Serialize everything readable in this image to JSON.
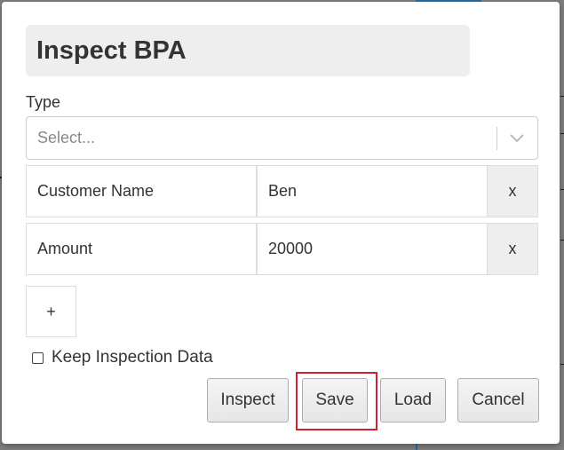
{
  "dialog": {
    "title": "Inspect BPA",
    "type_label": "Type",
    "type_select": {
      "placeholder": "Select...",
      "value": ""
    },
    "fields": [
      {
        "key": "Customer Name",
        "value": "Ben",
        "remove_label": "x"
      },
      {
        "key": "Amount",
        "value": "20000",
        "remove_label": "x"
      }
    ],
    "add_label": "+",
    "keep_inspection": {
      "label": "Keep Inspection Data",
      "checked": false
    },
    "buttons": {
      "inspect": "Inspect",
      "save": "Save",
      "load": "Load",
      "cancel": "Cancel"
    },
    "highlighted_button": "save"
  },
  "colors": {
    "highlight": "#d02030",
    "background_accent": "#1f6fb0"
  },
  "icons": {
    "select_arrow": "chevron-down-icon",
    "checkbox": "checkbox-unchecked-icon"
  }
}
